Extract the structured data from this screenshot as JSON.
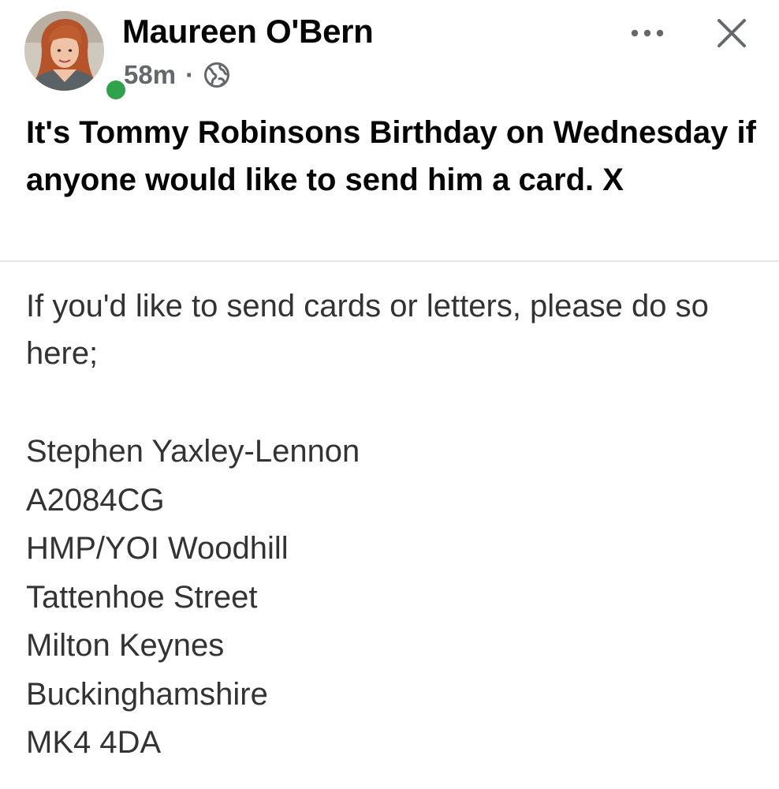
{
  "post": {
    "author": {
      "name": "Maureen O'Bern",
      "avatar_icon": "profile-photo-icon",
      "online": true,
      "online_color": "#31a24c"
    },
    "meta": {
      "time": "58m",
      "separator": "·",
      "audience_icon": "globe-icon"
    },
    "actions": {
      "more_icon": "more-options-icon",
      "close_icon": "close-icon"
    },
    "headline": "It's Tommy Robinsons Birthday on Wednesday if anyone would like to send him a card. X",
    "body": {
      "intro": "If you'd like to send cards or letters, please do so here;",
      "address_lines": [
        "Stephen Yaxley-Lennon",
        "A2084CG",
        "HMP/YOI Woodhill",
        "Tattenhoe Street",
        "Milton Keynes",
        "Buckinghamshire",
        "MK4 4DA"
      ]
    }
  },
  "colors": {
    "background": "#ffffff",
    "primary_text": "#050505",
    "secondary_text": "#65676b",
    "divider": "#e4e6eb"
  }
}
